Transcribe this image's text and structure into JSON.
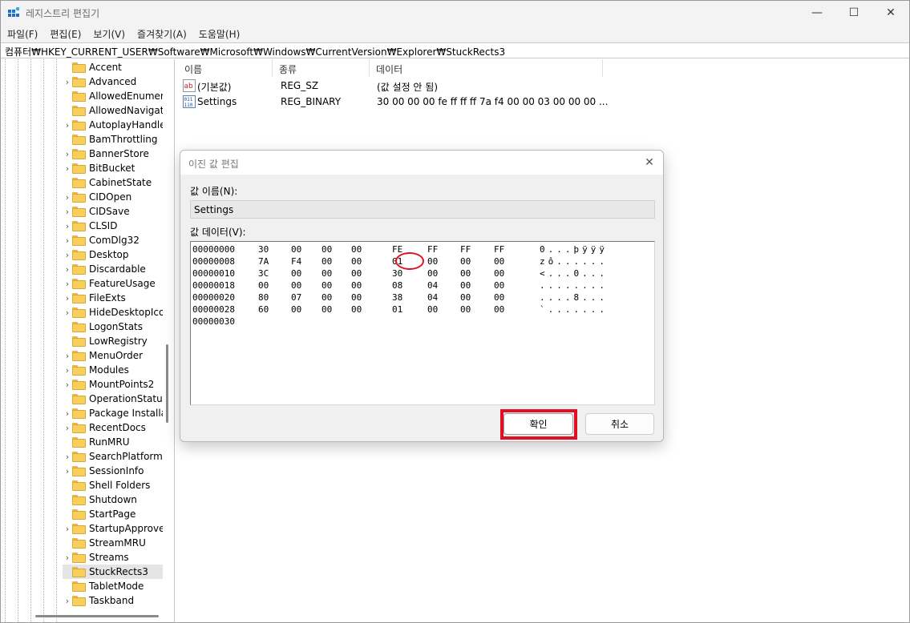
{
  "window": {
    "title": "레지스트리 편집기",
    "controls": {
      "minimize": "—",
      "maximize": "☐",
      "close": "✕"
    }
  },
  "menu": [
    "파일(F)",
    "편집(E)",
    "보기(V)",
    "즐겨찾기(A)",
    "도움말(H)"
  ],
  "address": "컴퓨터₩HKEY_CURRENT_USER₩Software₩Microsoft₩Windows₩CurrentVersion₩Explorer₩StuckRects3",
  "tree": {
    "items": [
      {
        "label": "Accent",
        "expandable": false
      },
      {
        "label": "Advanced",
        "expandable": true
      },
      {
        "label": "AllowedEnumeration",
        "expandable": false
      },
      {
        "label": "AllowedNavigation",
        "expandable": false
      },
      {
        "label": "AutoplayHandlers",
        "expandable": true
      },
      {
        "label": "BamThrottling",
        "expandable": false
      },
      {
        "label": "BannerStore",
        "expandable": true
      },
      {
        "label": "BitBucket",
        "expandable": true
      },
      {
        "label": "CabinetState",
        "expandable": false
      },
      {
        "label": "CIDOpen",
        "expandable": true
      },
      {
        "label": "CIDSave",
        "expandable": true
      },
      {
        "label": "CLSID",
        "expandable": true
      },
      {
        "label": "ComDlg32",
        "expandable": true
      },
      {
        "label": "Desktop",
        "expandable": true
      },
      {
        "label": "Discardable",
        "expandable": true
      },
      {
        "label": "FeatureUsage",
        "expandable": true
      },
      {
        "label": "FileExts",
        "expandable": true
      },
      {
        "label": "HideDesktopIcons",
        "expandable": true
      },
      {
        "label": "LogonStats",
        "expandable": false
      },
      {
        "label": "LowRegistry",
        "expandable": false
      },
      {
        "label": "MenuOrder",
        "expandable": true
      },
      {
        "label": "Modules",
        "expandable": true
      },
      {
        "label": "MountPoints2",
        "expandable": true
      },
      {
        "label": "OperationStatusManager",
        "expandable": false
      },
      {
        "label": "Package Installation",
        "expandable": true
      },
      {
        "label": "RecentDocs",
        "expandable": true
      },
      {
        "label": "RunMRU",
        "expandable": false
      },
      {
        "label": "SearchPlatform",
        "expandable": true
      },
      {
        "label": "SessionInfo",
        "expandable": true
      },
      {
        "label": "Shell Folders",
        "expandable": false
      },
      {
        "label": "Shutdown",
        "expandable": false
      },
      {
        "label": "StartPage",
        "expandable": false
      },
      {
        "label": "StartupApproved",
        "expandable": true
      },
      {
        "label": "StreamMRU",
        "expandable": false
      },
      {
        "label": "Streams",
        "expandable": true
      },
      {
        "label": "StuckRects3",
        "expandable": false,
        "selected": true
      },
      {
        "label": "TabletMode",
        "expandable": false
      },
      {
        "label": "Taskband",
        "expandable": true
      }
    ]
  },
  "list": {
    "columns": [
      "이름",
      "종류",
      "데이터"
    ],
    "rows": [
      {
        "icon": "string-value-icon",
        "name": "(기본값)",
        "type": "REG_SZ",
        "data": "(값 설정 안 됨)"
      },
      {
        "icon": "binary-value-icon",
        "name": "Settings",
        "type": "REG_BINARY",
        "data": "30 00 00 00 fe ff ff ff 7a f4 00 00 03 00 00 00 ..."
      }
    ]
  },
  "dialog": {
    "title": "이진 값 편집",
    "close": "✕",
    "name_label": "값 이름(N):",
    "name_value": "Settings",
    "data_label": "값 데이터(V):",
    "hex_lines": [
      {
        "addr": "00000000",
        "bytes": [
          "30",
          "00",
          "00",
          "00",
          "FE",
          "FF",
          "FF",
          "FF"
        ],
        "ascii": "0...þÿÿÿ"
      },
      {
        "addr": "00000008",
        "bytes": [
          "7A",
          "F4",
          "00",
          "00",
          "01",
          "00",
          "00",
          "00"
        ],
        "ascii": "zô......"
      },
      {
        "addr": "00000010",
        "bytes": [
          "3C",
          "00",
          "00",
          "00",
          "30",
          "00",
          "00",
          "00"
        ],
        "ascii": "<...0..."
      },
      {
        "addr": "00000018",
        "bytes": [
          "00",
          "00",
          "00",
          "00",
          "08",
          "04",
          "00",
          "00"
        ],
        "ascii": "........"
      },
      {
        "addr": "00000020",
        "bytes": [
          "80",
          "07",
          "00",
          "00",
          "38",
          "04",
          "00",
          "00"
        ],
        "ascii": "....8..."
      },
      {
        "addr": "00000028",
        "bytes": [
          "60",
          "00",
          "00",
          "00",
          "01",
          "00",
          "00",
          "00"
        ],
        "ascii": "`......."
      },
      {
        "addr": "00000030",
        "bytes": [],
        "ascii": ""
      }
    ],
    "ok_label": "확인",
    "cancel_label": "취소",
    "annotation_color": "#e01020"
  }
}
